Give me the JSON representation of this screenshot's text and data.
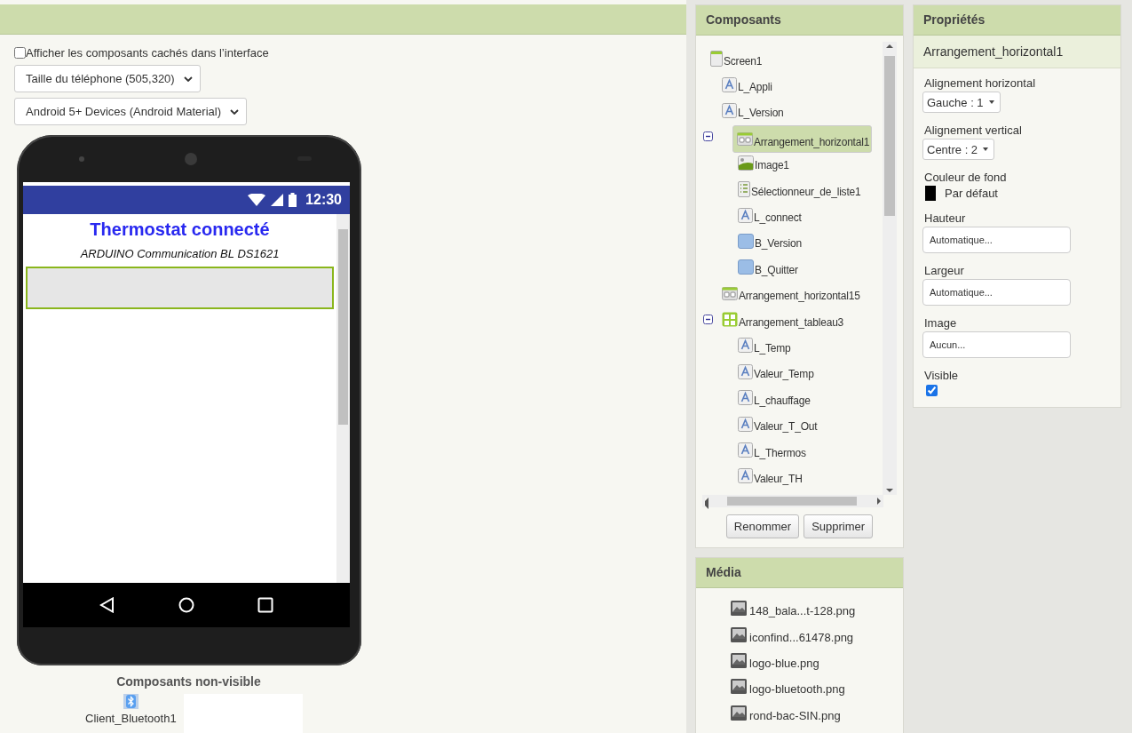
{
  "viewer": {
    "show_hidden": {
      "label": "Afficher les composants cachés dans l’interface",
      "checked": false
    },
    "selects": [
      "Taille du téléphone (505,320)",
      "Android 5+ Devices (Android Material)"
    ],
    "phone": {
      "time": "12:30",
      "title": "Thermostat connecté",
      "subtitle": "ARDUINO Communication BL DS1621",
      "arrangement_selected": true
    },
    "non_visible": {
      "title": "Composants non-visible",
      "items": [
        {
          "label": "Client_Bluetooth1",
          "kind": "bluetooth"
        }
      ]
    }
  },
  "components": {
    "title": "Composants",
    "tree": [
      {
        "label": "Screen1",
        "kind": "screen",
        "selected": false,
        "children": [
          {
            "label": "L_Appli",
            "kind": "label",
            "selected": false
          },
          {
            "label": "L_Version",
            "kind": "label",
            "selected": false
          },
          {
            "label": "Arrangement_horizontal1",
            "kind": "harr",
            "selected": true,
            "expanded": true,
            "children": [
              {
                "label": "Image1",
                "kind": "image",
                "selected": false
              },
              {
                "label": "Sélectionneur_de_liste1",
                "kind": "list",
                "selected": false
              },
              {
                "label": "L_connect",
                "kind": "label",
                "selected": false
              },
              {
                "label": "B_Version",
                "kind": "button",
                "selected": false
              },
              {
                "label": "B_Quitter",
                "kind": "button",
                "selected": false
              }
            ]
          },
          {
            "label": "Arrangement_horizontal15",
            "kind": "harr",
            "selected": false
          },
          {
            "label": "Arrangement_tableau3",
            "kind": "table",
            "selected": false,
            "expanded": true,
            "children": [
              {
                "label": "L_Temp",
                "kind": "label",
                "selected": false
              },
              {
                "label": "Valeur_Temp",
                "kind": "label",
                "selected": false
              },
              {
                "label": "L_chauffage",
                "kind": "label",
                "selected": false
              },
              {
                "label": "Valeur_T_Out",
                "kind": "label",
                "selected": false
              },
              {
                "label": "L_Thermos",
                "kind": "label",
                "selected": false
              },
              {
                "label": "Valeur_TH",
                "kind": "label",
                "selected": false
              }
            ]
          }
        ]
      }
    ],
    "buttons": [
      "Renommer",
      "Supprimer"
    ]
  },
  "media": {
    "title": "Média",
    "items": [
      "148_bala...t-128.png",
      "iconfind...61478.png",
      "logo-blue.png",
      "logo-bluetooth.png",
      "rond-bac-SIN.png"
    ]
  },
  "properties": {
    "title": "Propriétés",
    "component": "Arrangement_horizontal1",
    "items": [
      {
        "label": "Alignement horizontal",
        "kind": "select",
        "value": "Gauche : 1"
      },
      {
        "label": "Alignement vertical",
        "kind": "select",
        "value": "Centre : 2"
      },
      {
        "label": "Couleur de fond",
        "kind": "color",
        "value": "Par défaut",
        "color": "#000000"
      },
      {
        "label": "Hauteur",
        "kind": "field",
        "value": "Automatique..."
      },
      {
        "label": "Largeur",
        "kind": "field",
        "value": "Automatique..."
      },
      {
        "label": "Image",
        "kind": "field",
        "value": "Aucun..."
      },
      {
        "label": "Visible",
        "kind": "checkbox",
        "checked": true
      }
    ]
  }
}
